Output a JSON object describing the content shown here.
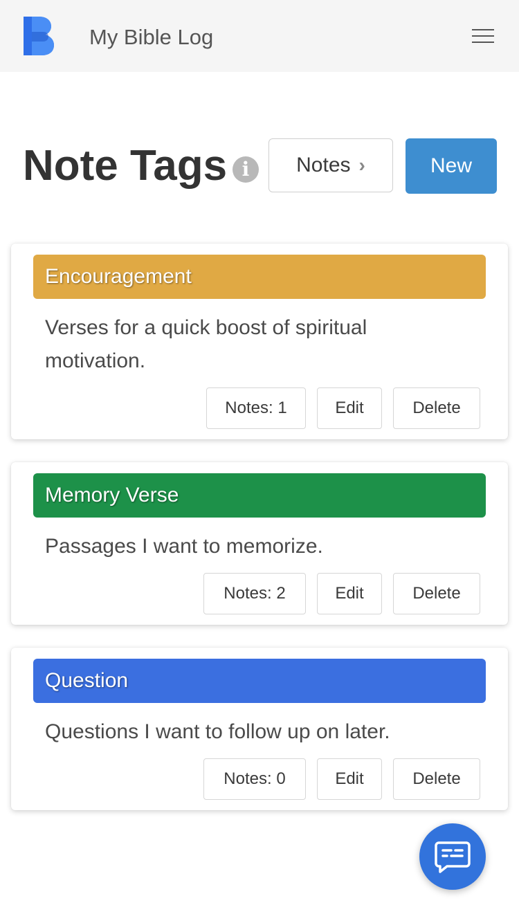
{
  "navbar": {
    "title": "My Bible Log",
    "logo_letter": "B",
    "logo_icon": "book-logo-icon",
    "menu_icon": "hamburger-menu-icon"
  },
  "header": {
    "title": "Note Tags",
    "info_icon": "info-icon",
    "info_glyph": "i",
    "notes_button_label": "Notes",
    "notes_button_icon": "chevron-right-icon",
    "new_button_label": "New"
  },
  "tags": [
    {
      "name": "Encouragement",
      "color": "#e0a944",
      "description": "Verses for a quick boost of spiritual motivation.",
      "notes_label": "Notes: 1",
      "edit_label": "Edit",
      "delete_label": "Delete"
    },
    {
      "name": "Memory Verse",
      "color": "#1d9149",
      "description": "Passages I want to memorize.",
      "notes_label": "Notes: 2",
      "edit_label": "Edit",
      "delete_label": "Delete"
    },
    {
      "name": "Question",
      "color": "#3b6fe0",
      "description": "Questions I want to follow up on later.",
      "notes_label": "Notes: 0",
      "edit_label": "Edit",
      "delete_label": "Delete"
    }
  ],
  "fab": {
    "icon": "chat-message-icon",
    "color": "#3273dc"
  }
}
